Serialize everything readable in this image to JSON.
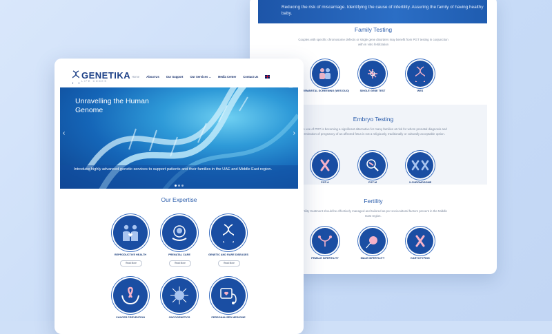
{
  "back": {
    "banner_text": "Reducing the risk of miscarriage. Identifying the cause of infertility. Assuring the family of having healthy baby.",
    "family": {
      "title": "Family Testing",
      "desc": "Couples with specific chromosome defects or single gene disorders may benefit from PGT testing in conjunction with in vitro fertilization",
      "items": [
        {
          "label": "PREMARITAL SCREENING (WES DUO)",
          "icon": "couple-icon"
        },
        {
          "label": "SINGLE GENE TEST",
          "icon": "molecule-icon"
        },
        {
          "label": "WES",
          "icon": "dna-icon"
        }
      ]
    },
    "embryo": {
      "title": "Embryo Testing",
      "desc": "The use of PGT is becoming a significant alternative for many families at risk for whom prenatal diagnosis and termination of pregnancy of an affected fetus is not a religiously, traditionally or culturally acceptable option.",
      "items": [
        {
          "label": "PGT-A",
          "icon": "chromosome-icon"
        },
        {
          "label": "PGT-M",
          "icon": "magnifier-icon"
        },
        {
          "label": "X-CHROMOSOME",
          "icon": "x-chromosome-icon"
        }
      ]
    },
    "fertility": {
      "title": "Fertility",
      "desc": "Fertility treatment should be effectively managed and tailored as per sociocultural factors present in the Middle East region.",
      "items": [
        {
          "label": "FEMALE INFERTILITY",
          "icon": "uterus-icon"
        },
        {
          "label": "MALE INFERTILITY",
          "icon": "sperm-icon"
        },
        {
          "label": "KARYOTYPING",
          "icon": "karyotype-icon"
        }
      ]
    }
  },
  "front": {
    "logo": {
      "name": "GENETIKA",
      "tagline": "LIFE CODES"
    },
    "nav": {
      "home": "Home",
      "about": "About Us",
      "support": "Our Support",
      "services": "Our Services",
      "media": "Media Center",
      "contact": "Contact Us"
    },
    "hero": {
      "title": "Unravelling the Human Genome",
      "desc": "Introduce highly advanced genetic services to support patients and their families in the UAE and Middle East region."
    },
    "expertise": {
      "title": "Our Expertise",
      "read_more": "Read More",
      "items": [
        {
          "label": "REPRODUCTIVE HEALTH",
          "icon": "family-icon"
        },
        {
          "label": "PRENATAL CARE",
          "icon": "fetus-icon"
        },
        {
          "label": "GENETIC AND RARE DISEASES",
          "icon": "dna-icon"
        },
        {
          "label": "CANCER PREVENTION",
          "icon": "ribbon-hands-icon"
        },
        {
          "label": "ONCOGENETICS",
          "icon": "cell-icon"
        },
        {
          "label": "PERSONALIZED MEDICINE",
          "icon": "stethoscope-icon"
        }
      ]
    }
  },
  "colors": {
    "brand": "#1a4ea3",
    "accent": "#2a5cab",
    "background": "#cfe0f8"
  }
}
